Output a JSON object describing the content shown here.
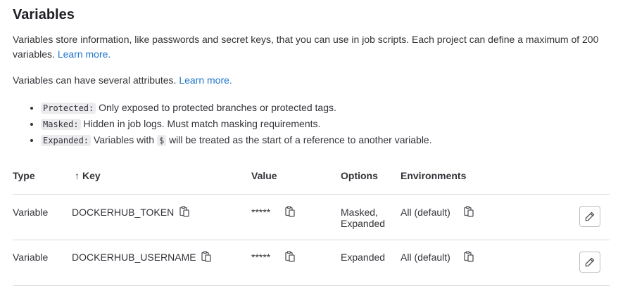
{
  "section": {
    "title": "Variables",
    "description": "Variables store information, like passwords and secret keys, that you can use in job scripts. Each project can define a maximum of 200 variables.",
    "learn_more": "Learn more.",
    "attributes_intro": "Variables can have several attributes.",
    "attributes_learn_more": "Learn more."
  },
  "attributes": [
    {
      "code": "Protected:",
      "text": "Only exposed to protected branches or protected tags."
    },
    {
      "code": "Masked:",
      "text": "Hidden in job logs. Must match masking requirements."
    },
    {
      "code": "Expanded:",
      "pre": "Variables with",
      "code2": "$",
      "post": "will be treated as the start of a reference to another variable."
    }
  ],
  "table": {
    "headers": {
      "type": "Type",
      "key": "Key",
      "value": "Value",
      "options": "Options",
      "environments": "Environments"
    },
    "sort_icon": "↑",
    "rows": [
      {
        "type": "Variable",
        "key": "DOCKERHUB_TOKEN",
        "value": "*****",
        "options_line1": "Masked,",
        "options_line2": "Expanded",
        "environment": "All (default)"
      },
      {
        "type": "Variable",
        "key": "DOCKERHUB_USERNAME",
        "value": "*****",
        "options_line1": "Expanded",
        "options_line2": "",
        "environment": "All (default)"
      }
    ]
  },
  "icons": {
    "copy": "copy-to-clipboard-icon",
    "edit": "pencil-icon"
  },
  "colors": {
    "link": "#1f75cb",
    "code_bg": "#ececef",
    "border": "#dcdcde"
  }
}
